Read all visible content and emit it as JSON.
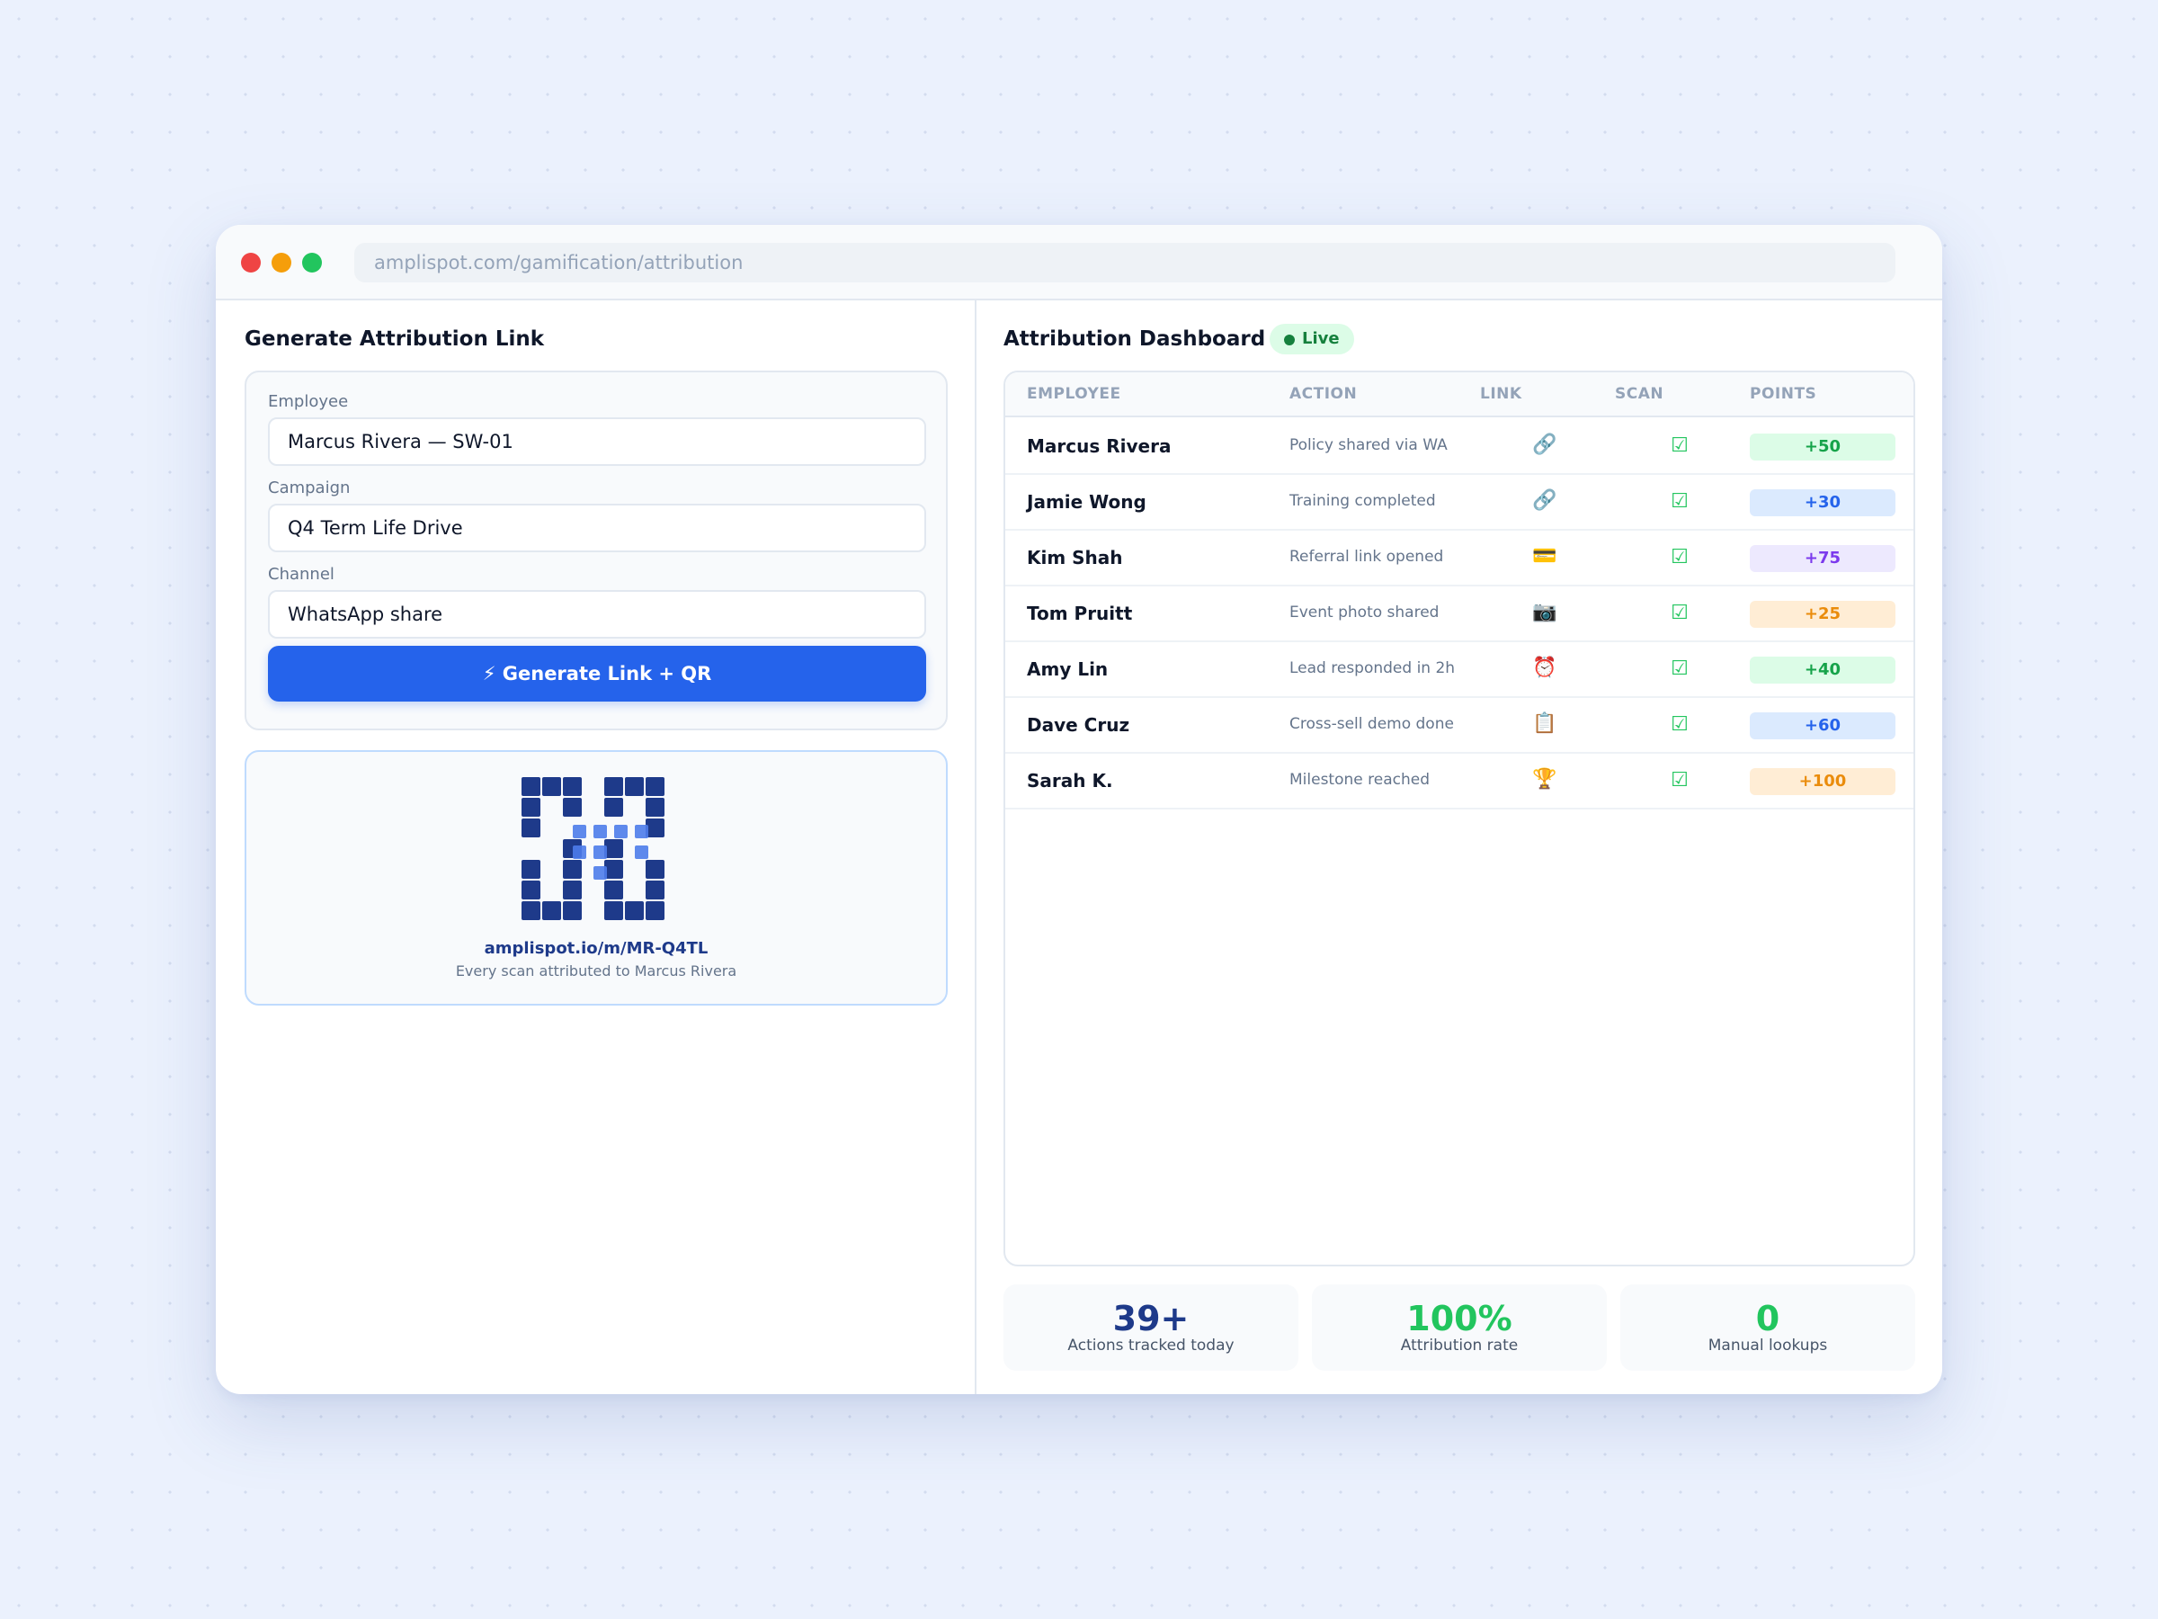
{
  "browser": {
    "url": "amplispot.com/gamification/attribution"
  },
  "generator": {
    "title": "Generate Attribution Link",
    "employee_label": "Employee",
    "employee_value": "Marcus Rivera — SW-01",
    "campaign_label": "Campaign",
    "campaign_value": "Q4 Term Life Drive",
    "channel_label": "Channel",
    "channel_value": "WhatsApp share",
    "button_label": "⚡ Generate Link + QR"
  },
  "qr": {
    "link": "amplispot.io/m/MR-Q4TL",
    "caption": "Every scan attributed to Marcus Rivera"
  },
  "dashboard": {
    "title": "Attribution Dashboard",
    "live_label": "Live",
    "columns": [
      "EMPLOYEE",
      "ACTION",
      "LINK",
      "SCAN",
      "POINTS"
    ],
    "rows": [
      {
        "employee": "Marcus Rivera",
        "action": "Policy shared via WA",
        "link_icon": "🔗",
        "link_icon_name": "link-icon",
        "scan": "☑",
        "points": "+50",
        "color": "#16a34a",
        "bg": "#dcfce7"
      },
      {
        "employee": "Jamie Wong",
        "action": "Training completed",
        "link_icon": "🔗",
        "link_icon_name": "link-icon",
        "scan": "☑",
        "points": "+30",
        "color": "#2563eb",
        "bg": "#dbeafe"
      },
      {
        "employee": "Kim Shah",
        "action": "Referral link opened",
        "link_icon": "💳",
        "link_icon_name": "credit-card-icon",
        "scan": "☑",
        "points": "+75",
        "color": "#7c3aed",
        "bg": "#ede9fe"
      },
      {
        "employee": "Tom Pruitt",
        "action": "Event photo shared",
        "link_icon": "📷",
        "link_icon_name": "camera-icon",
        "scan": "☑",
        "points": "+25",
        "color": "#ea8c0c",
        "bg": "#ffedd5"
      },
      {
        "employee": "Amy Lin",
        "action": "Lead responded in 2h",
        "link_icon": "⏰",
        "link_icon_name": "alarm-clock-icon",
        "scan": "☑",
        "points": "+40",
        "color": "#16a34a",
        "bg": "#dcfce7"
      },
      {
        "employee": "Dave Cruz",
        "action": "Cross-sell demo done",
        "link_icon": "📋",
        "link_icon_name": "clipboard-icon",
        "scan": "☑",
        "points": "+60",
        "color": "#2563eb",
        "bg": "#dbeafe"
      },
      {
        "employee": "Sarah K.",
        "action": "Milestone reached",
        "link_icon": "🏆",
        "link_icon_name": "trophy-icon",
        "scan": "☑",
        "points": "+100",
        "color": "#ea8c0c",
        "bg": "#ffedd5"
      }
    ]
  },
  "stats": [
    {
      "value": "39+",
      "label": "Actions tracked today",
      "color": "#1e3a8a"
    },
    {
      "value": "100%",
      "label": "Attribution rate",
      "color": "#22c55e"
    },
    {
      "value": "0",
      "label": "Manual lookups",
      "color": "#22c55e"
    }
  ],
  "colors": {
    "accent": "#2563eb",
    "qr_dark": "#1e3a8a",
    "qr_light": "#4c7cea",
    "live": "#15803d"
  }
}
